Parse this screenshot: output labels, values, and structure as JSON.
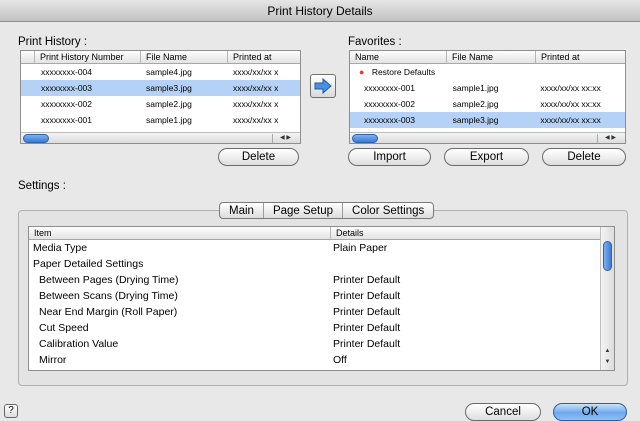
{
  "window": {
    "title": "Print History Details"
  },
  "history": {
    "label": "Print History :",
    "columns": [
      "Print History Number",
      "File Name",
      "Printed at"
    ],
    "rows": [
      {
        "number": "xxxxxxxx-004",
        "file": "sample4.jpg",
        "printed": "xxxx/xx/xx x",
        "selected": false
      },
      {
        "number": "xxxxxxxx-003",
        "file": "sample3.jpg",
        "printed": "xxxx/xx/xx x",
        "selected": true
      },
      {
        "number": "xxxxxxxx-002",
        "file": "sample2.jpg",
        "printed": "xxxx/xx/xx x",
        "selected": false
      },
      {
        "number": "xxxxxxxx-001",
        "file": "sample1.jpg",
        "printed": "xxxx/xx/xx x",
        "selected": false
      }
    ],
    "delete_label": "Delete"
  },
  "favorites": {
    "label": "Favorites :",
    "columns": [
      "Name",
      "File Name",
      "Printed at"
    ],
    "restore_label": "Restore Defaults",
    "rows": [
      {
        "number": "xxxxxxxx-001",
        "file": "sample1.jpg",
        "printed": "xxxx/xx/xx xx:xx",
        "selected": false
      },
      {
        "number": "xxxxxxxx-002",
        "file": "sample2.jpg",
        "printed": "xxxx/xx/xx xx:xx",
        "selected": false
      },
      {
        "number": "xxxxxxxx-003",
        "file": "sample3.jpg",
        "printed": "xxxx/xx/xx xx:xx",
        "selected": true
      }
    ],
    "import_label": "Import",
    "export_label": "Export",
    "delete_label": "Delete"
  },
  "settings": {
    "label": "Settings :",
    "tabs": [
      {
        "label": "Main",
        "active": true
      },
      {
        "label": "Page Setup",
        "active": false
      },
      {
        "label": "Color Settings",
        "active": false
      }
    ],
    "columns": [
      "Item",
      "Details"
    ],
    "rows": [
      {
        "item": "Media Type",
        "details": "Plain Paper",
        "indent": 0
      },
      {
        "item": "Paper Detailed Settings",
        "details": "",
        "indent": 0
      },
      {
        "item": "Between Pages (Drying Time)",
        "details": "Printer Default",
        "indent": 1
      },
      {
        "item": "Between Scans (Drying Time)",
        "details": "Printer Default",
        "indent": 1
      },
      {
        "item": "Near End Margin (Roll Paper)",
        "details": "Printer Default",
        "indent": 1
      },
      {
        "item": "Cut Speed",
        "details": "Printer Default",
        "indent": 1
      },
      {
        "item": "Calibration Value",
        "details": "Printer Default",
        "indent": 1
      },
      {
        "item": "Mirror",
        "details": "Off",
        "indent": 1
      }
    ]
  },
  "footer": {
    "help_glyph": "?",
    "cancel_label": "Cancel",
    "ok_label": "OK"
  },
  "icons": {
    "transfer_arrow": "right-arrow-icon",
    "help": "help-icon",
    "restore_marker": "red-dot-icon"
  },
  "colors": {
    "selection": "#b5d1f5",
    "accent": "#3b7ad5"
  }
}
